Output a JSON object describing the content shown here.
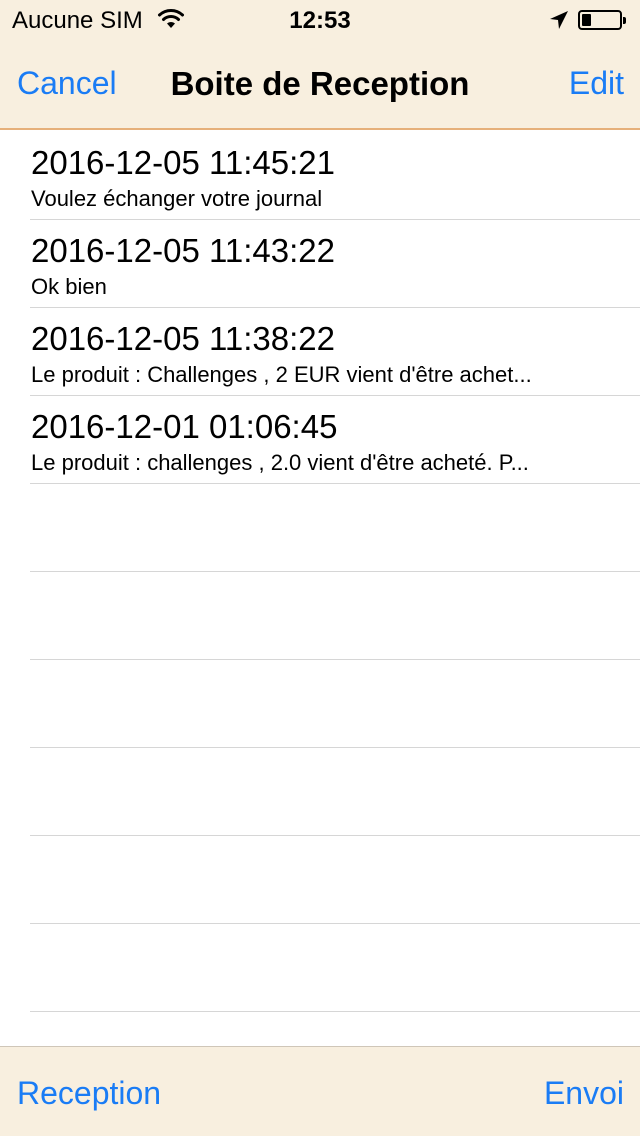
{
  "status_bar": {
    "carrier": "Aucune SIM",
    "time": "12:53",
    "wifi_icon": "wifi-icon",
    "location_icon": "location-arrow-icon",
    "battery_icon": "battery-icon"
  },
  "nav": {
    "cancel_label": "Cancel",
    "title": "Boite de Reception",
    "edit_label": "Edit"
  },
  "messages": [
    {
      "date": "2016-12-05 11:45:21",
      "preview": "Voulez échanger votre journal"
    },
    {
      "date": "2016-12-05 11:43:22",
      "preview": "Ok bien"
    },
    {
      "date": "2016-12-05 11:38:22",
      "preview": "Le produit : Challenges , 2 EUR vient d'être achet..."
    },
    {
      "date": "2016-12-01 01:06:45",
      "preview": "Le produit : challenges , 2.0 vient d'être acheté. P..."
    }
  ],
  "tabbar": {
    "reception_label": "Reception",
    "envoi_label": "Envoi"
  },
  "colors": {
    "accent": "#1a7cf5",
    "bar_background": "#f8efdf",
    "nav_border": "#e6b07a",
    "separator": "#d6d6d6"
  }
}
